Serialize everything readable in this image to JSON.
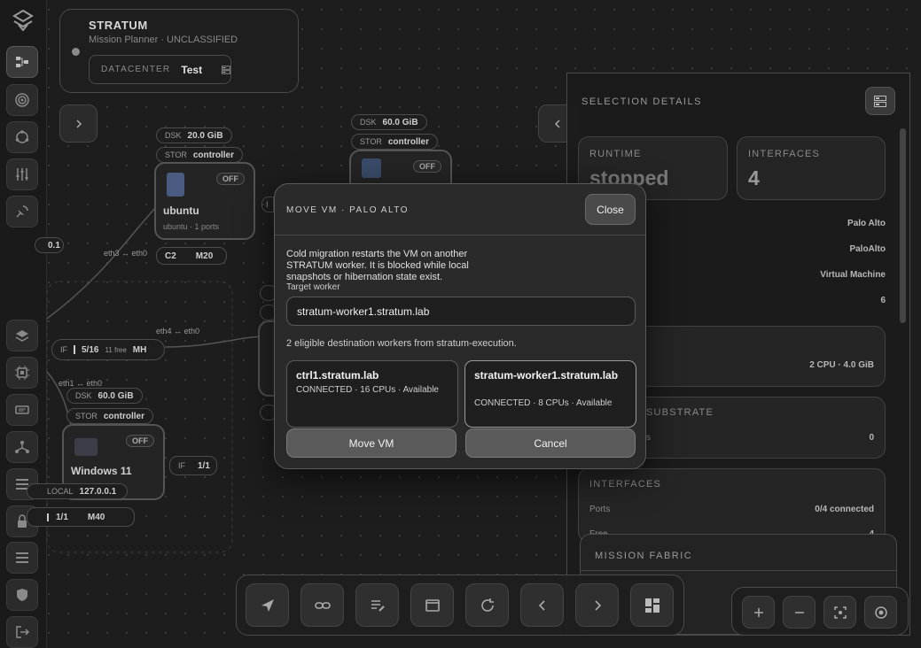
{
  "colors": {
    "background": "#1d1d1d",
    "panel": "#1e1e1e",
    "border": "#4a4a4a",
    "accent": "#5a5a5a"
  },
  "rail": {
    "icons": [
      "logo-icon",
      "topology-icon",
      "target-icon",
      "network-icon",
      "equalizer-icon",
      "satellite-icon",
      "layers-icon",
      "chip-icon",
      "storage-icon",
      "hierarchy-icon",
      "list-icon",
      "lock-icon",
      "list-icon",
      "shield-icon",
      "logout-icon"
    ]
  },
  "header": {
    "title": "STRATUM",
    "subtitle": "Mission Planner · UNCLASSIFIED",
    "datacenter_label": "DATACENTER",
    "datacenter_value": "Test"
  },
  "canvas": {
    "nodes": [
      {
        "id": "ubuntu",
        "title": "ubuntu",
        "subtitle": "ubuntu · 1 ports",
        "status": "OFF",
        "dsk_label": "DSK",
        "dsk_value": "20.0 GiB",
        "stor_label": "STOR",
        "stor_value": "controller",
        "tag_left": "C2",
        "tag_right": "M20"
      },
      {
        "id": "node-top",
        "status": "OFF",
        "dsk_label": "DSK",
        "dsk_value": "60.0 GiB",
        "stor_label": "STOR",
        "stor_value": "controller"
      },
      {
        "id": "windows",
        "title": "Windows 11",
        "status": "OFF",
        "dsk_label": "DSK",
        "dsk_value": "60.0 GiB",
        "stor_label": "STOR",
        "stor_value": "controller",
        "local_label": "LOCAL",
        "local_value": "127.0.0.1",
        "if_label": "IF",
        "if_value": "1/1",
        "m_value": "M40"
      }
    ],
    "edges": [
      {
        "label": "eth3 ↔ eth0"
      },
      {
        "label": "eth4 ↔ eth0"
      },
      {
        "label": "eth1 ↔ eth0"
      }
    ],
    "if_tag": {
      "label": "IF",
      "value": "5/16",
      "free": "11 free",
      "suffix": "MH"
    },
    "partial_label": "0.1"
  },
  "selection": {
    "title": "SELECTION DETAILS",
    "runtime_label": "RUNTIME",
    "runtime_value": "stopped",
    "interfaces_label": "INTERFACES",
    "interfaces_value": "4",
    "rows": [
      "Palo Alto",
      "PaloAlto",
      "Virtual Machine",
      "6"
    ],
    "resources_value": "2 CPU · 4.0 GiB",
    "substrate_label": "SUBSTRATE",
    "substrate_value": "0",
    "substrate_key_partial": "s",
    "interfaces_section": "INTERFACES",
    "ports_label": "Ports",
    "ports_value": "0/4 connected",
    "free_label": "Free",
    "free_value": "4",
    "fabric_title": "MISSION FABRIC"
  },
  "modal": {
    "title": "MOVE VM · PALO ALTO",
    "close_label": "Close",
    "description": "Cold migration restarts the VM on another STRATUM worker. It is blocked while local snapshots or hibernation state exist.",
    "target_label": "Target worker",
    "target_value": "stratum-worker1.stratum.lab",
    "eligible_text": "2 eligible destination workers from stratum-execution.",
    "workers": [
      {
        "name": "ctrl1.stratum.lab",
        "meta": "CONNECTED · 16 CPUs · Available"
      },
      {
        "name": "stratum-worker1.stratum.lab",
        "meta": "CONNECTED · 8 CPUs · Available"
      }
    ],
    "move_label": "Move VM",
    "cancel_label": "Cancel"
  },
  "toolbar": {
    "icons": [
      "navigate-icon",
      "link-icon",
      "edit-list-icon",
      "window-icon",
      "refresh-icon",
      "chevron-left-icon",
      "chevron-right-icon",
      "dashboard-icon"
    ]
  },
  "zoom": {
    "icons": [
      "zoom-in-icon",
      "zoom-out-icon",
      "fit-view-icon",
      "focus-icon"
    ]
  }
}
